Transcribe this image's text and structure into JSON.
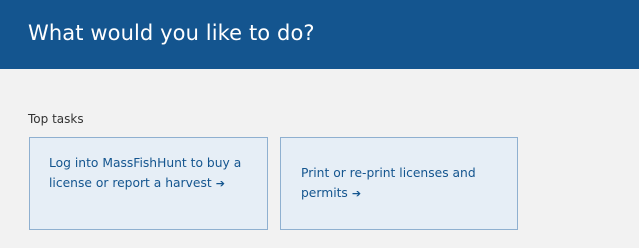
{
  "header": {
    "title": "What would you like to do?"
  },
  "top_tasks": {
    "label": "Top tasks",
    "cards": [
      {
        "text": "Log into MassFishHunt to buy a license or report a harvest",
        "icon": "arrow-right-icon"
      },
      {
        "text": "Print or re-print licenses and permits",
        "icon": "arrow-right-icon"
      }
    ]
  },
  "colors": {
    "header_bg": "#14558f",
    "card_bg": "#e6eef6",
    "card_border": "#8fb0d0",
    "link_text": "#14558f",
    "page_bg": "#f2f2f2"
  }
}
